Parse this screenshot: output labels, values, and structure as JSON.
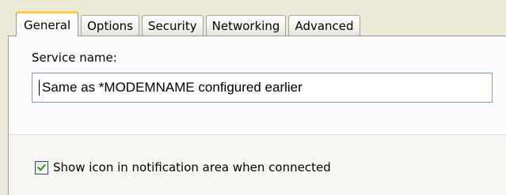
{
  "tabs": [
    {
      "label": "General",
      "active": true
    },
    {
      "label": "Options",
      "active": false
    },
    {
      "label": "Security",
      "active": false
    },
    {
      "label": "Networking",
      "active": false
    },
    {
      "label": "Advanced",
      "active": false
    }
  ],
  "general": {
    "service_name_label": "Service name:",
    "service_name_value": "Same as *MODEMNAME configured earlier",
    "show_icon_label": "Show icon in notification area when connected",
    "show_icon_checked": true
  },
  "colors": {
    "active_tab_accent": "#ffc83c",
    "input_border": "#7f9db9",
    "checkmark": "#21a121"
  },
  "icons": {
    "checkbox_check": "checkmark-icon"
  }
}
